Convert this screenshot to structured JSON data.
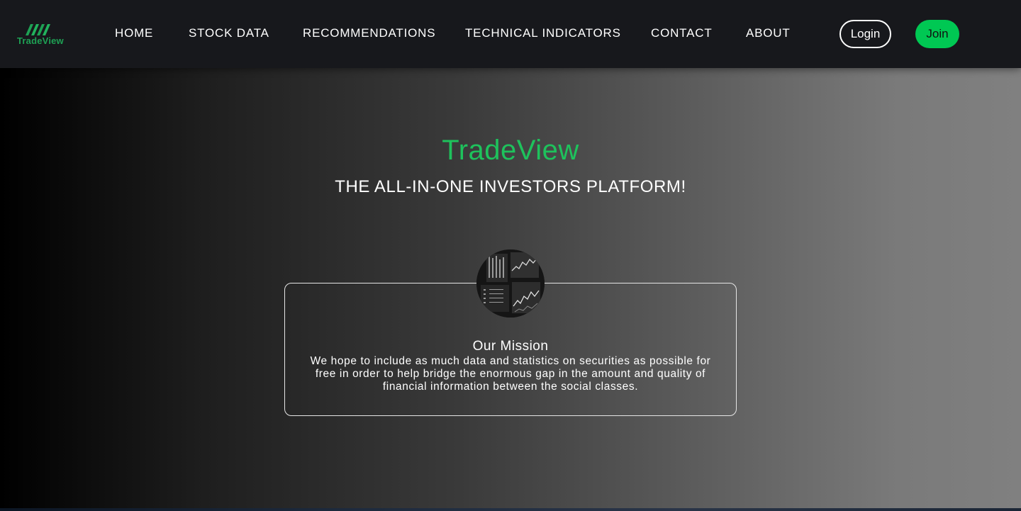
{
  "brand": {
    "logo_text": "TradeView",
    "logo_icon": "chart-bars-logo-icon",
    "accent_color": "#00c853"
  },
  "nav": {
    "links": [
      {
        "label": "HOME"
      },
      {
        "label": "STOCK DATA"
      },
      {
        "label": "RECOMMENDATIONS"
      },
      {
        "label": "TECHNICAL INDICATORS"
      },
      {
        "label": "CONTACT"
      },
      {
        "label": "ABOUT"
      }
    ],
    "login_label": "Login",
    "join_label": "Join"
  },
  "hero": {
    "title": "TradeView",
    "subtitle": "THE ALL-IN-ONE INVESTORS PLATFORM!"
  },
  "mission": {
    "image": "stock-chart-screens-image",
    "title": "Our Mission",
    "text": "We hope to include as much data and statistics on securities as possible for free in order to help bridge the enormous gap in the amount and quality of financial information between the social classes."
  }
}
